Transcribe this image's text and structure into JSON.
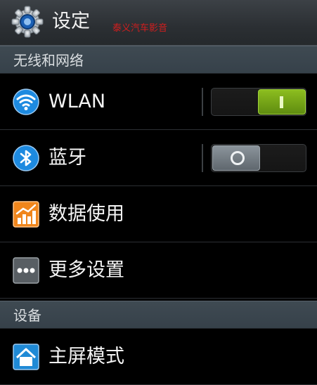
{
  "header": {
    "title": "设定",
    "watermark": "泰义汽车影音"
  },
  "sections": [
    {
      "label": "无线和网络"
    },
    {
      "label": "设备"
    }
  ],
  "items": [
    {
      "label": "WLAN",
      "icon": "wifi-icon",
      "toggle": "on"
    },
    {
      "label": "蓝牙",
      "icon": "bluetooth-icon",
      "toggle": "off"
    },
    {
      "label": "数据使用",
      "icon": "data-usage-icon"
    },
    {
      "label": "更多设置",
      "icon": "more-icon"
    },
    {
      "label": "主屏模式",
      "icon": "home-icon"
    }
  ],
  "colors": {
    "accent": "#8cbd1f",
    "header_bg": "#2b2f33",
    "section_bg": "#3a454d"
  }
}
